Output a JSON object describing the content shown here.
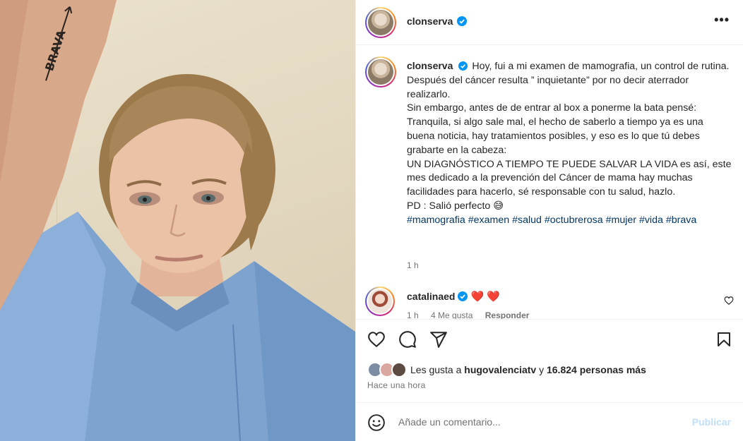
{
  "post": {
    "author": "clonserva",
    "caption_lines": [
      "Hoy, fui a mi examen de mamografia, un control de rutina.",
      "Después del cáncer resulta ” inquietante” por no decir aterrador realizarlo.",
      "Sin embargo, antes de de entrar al box a ponerme la bata pensé: Tranquila, si algo sale mal, el hecho de saberlo a tiempo ya es una buena noticia, hay tratamientos posibles, y eso es lo que tú debes grabarte en la cabeza:",
      "UN DIAGNÓSTICO A TIEMPO TE PUEDE SALVAR LA VIDA es así, este mes dedicado a la prevención del Cáncer de mama hay muchas facilidades para hacerlo, sé responsable con tu salud, hazlo.",
      "PD : Salió perfecto 😅"
    ],
    "hashtags": [
      "#mamografia",
      "#examen",
      "#salud",
      "#octubrerosa",
      "#mujer",
      "#vida",
      "#brava"
    ],
    "caption_time": "1 h"
  },
  "comment": {
    "user": "catalinaed",
    "text": "❤️ ❤️",
    "time": "1 h",
    "likes": "4 Me gusta",
    "reply": "Responder"
  },
  "likes": {
    "prefix": "Les gusta a",
    "user": "hugovalenciatv",
    "middle": "y",
    "count": "16.824 personas más"
  },
  "posted_ago": "Hace una hora",
  "comment_box": {
    "placeholder": "Añade un comentario...",
    "publish": "Publicar"
  },
  "tattoo_text": "BRAVA",
  "colors": {
    "link": "#00376b",
    "verified": "#0095f6",
    "publish_disabled": "#c0dffd",
    "heart": "#ed1b2e"
  },
  "icons": [
    "more-options-icon",
    "verified-icon",
    "heart-icon",
    "comment-icon",
    "share-icon",
    "bookmark-icon",
    "emoji-icon"
  ]
}
